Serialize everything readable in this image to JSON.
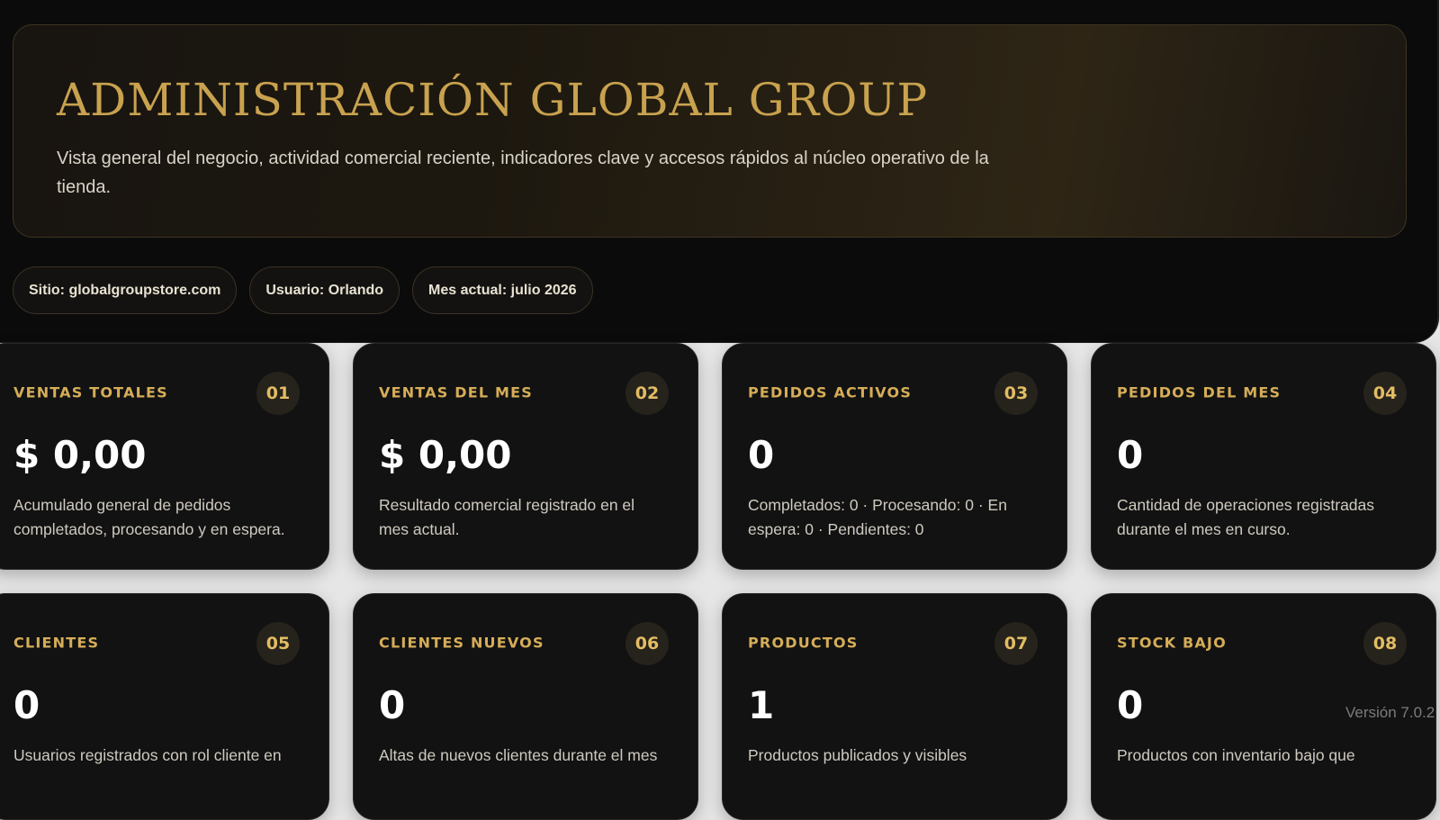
{
  "header": {
    "title": "ADMINISTRACIÓN GLOBAL GROUP",
    "subtitle": "Vista general del negocio, actividad comercial reciente, indicadores clave y accesos rápidos al núcleo operativo de la tienda."
  },
  "chips": [
    "Sitio: globalgroupstore.com",
    "Usuario: Orlando",
    "Mes actual: julio 2026"
  ],
  "cards": [
    {
      "label": "VENTAS TOTALES",
      "num": "01",
      "value": "$ 0,00",
      "desc": "Acumulado general de pedidos completados, procesando y en espera."
    },
    {
      "label": "VENTAS DEL MES",
      "num": "02",
      "value": "$ 0,00",
      "desc": "Resultado comercial registrado en el mes actual."
    },
    {
      "label": "PEDIDOS ACTIVOS",
      "num": "03",
      "value": "0",
      "desc": "Completados: 0 · Procesando: 0 · En espera: 0 · Pendientes: 0"
    },
    {
      "label": "PEDIDOS DEL MES",
      "num": "04",
      "value": "0",
      "desc": "Cantidad de operaciones registradas durante el mes en curso."
    },
    {
      "label": "CLIENTES",
      "num": "05",
      "value": "0",
      "desc": "Usuarios registrados con rol cliente en"
    },
    {
      "label": "CLIENTES NUEVOS",
      "num": "06",
      "value": "0",
      "desc": "Altas de nuevos clientes durante el mes"
    },
    {
      "label": "PRODUCTOS",
      "num": "07",
      "value": "1",
      "desc": "Productos publicados y visibles"
    },
    {
      "label": "STOCK BAJO",
      "num": "08",
      "value": "0",
      "desc": "Productos con inventario bajo que"
    }
  ],
  "footer": {
    "version": "Versión 7.0.2"
  },
  "colors": {
    "accent_gold": "#c9a24f",
    "panel_dark": "#0b0b0b",
    "card_bg": "#121212"
  }
}
